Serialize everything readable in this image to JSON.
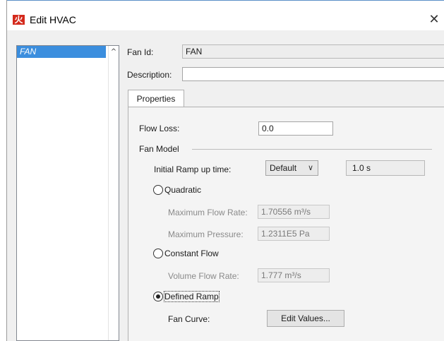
{
  "window": {
    "title": "Edit HVAC",
    "close_glyph": "✕",
    "app_icon_glyph": "火"
  },
  "tree": {
    "items": [
      {
        "label": "FAN",
        "selected": true
      }
    ],
    "scroll_up_glyph": "^"
  },
  "form": {
    "fan_id_label": "Fan Id:",
    "fan_id_value": "FAN",
    "description_label": "Description:",
    "description_value": ""
  },
  "tabs": [
    {
      "label": "Properties",
      "active": true
    }
  ],
  "properties": {
    "flow_loss_label": "Flow Loss:",
    "flow_loss_value": "0.0",
    "fan_model_label": "Fan Model",
    "ramp_label": "Initial Ramp up time:",
    "ramp_select_value": "Default",
    "ramp_chevron": "∨",
    "ramp_time_value": "1.0 s",
    "quadratic": {
      "label": "Quadratic",
      "selected": false,
      "max_flow_label": "Maximum Flow Rate:",
      "max_flow_value": "1.70556 m³/s",
      "max_pressure_label": "Maximum Pressure:",
      "max_pressure_value": "1.2311E5 Pa"
    },
    "constant_flow": {
      "label": "Constant Flow",
      "selected": false,
      "volume_flow_label": "Volume Flow Rate:",
      "volume_flow_value": "1.777 m³/s"
    },
    "defined_ramp": {
      "label": "Defined Ramp",
      "selected": true,
      "fan_curve_label": "Fan Curve:",
      "edit_values_label": "Edit Values..."
    }
  },
  "colors": {
    "selection": "#3b8ede",
    "app_icon": "#d42a1c",
    "title_border": "#5a8fc7"
  }
}
